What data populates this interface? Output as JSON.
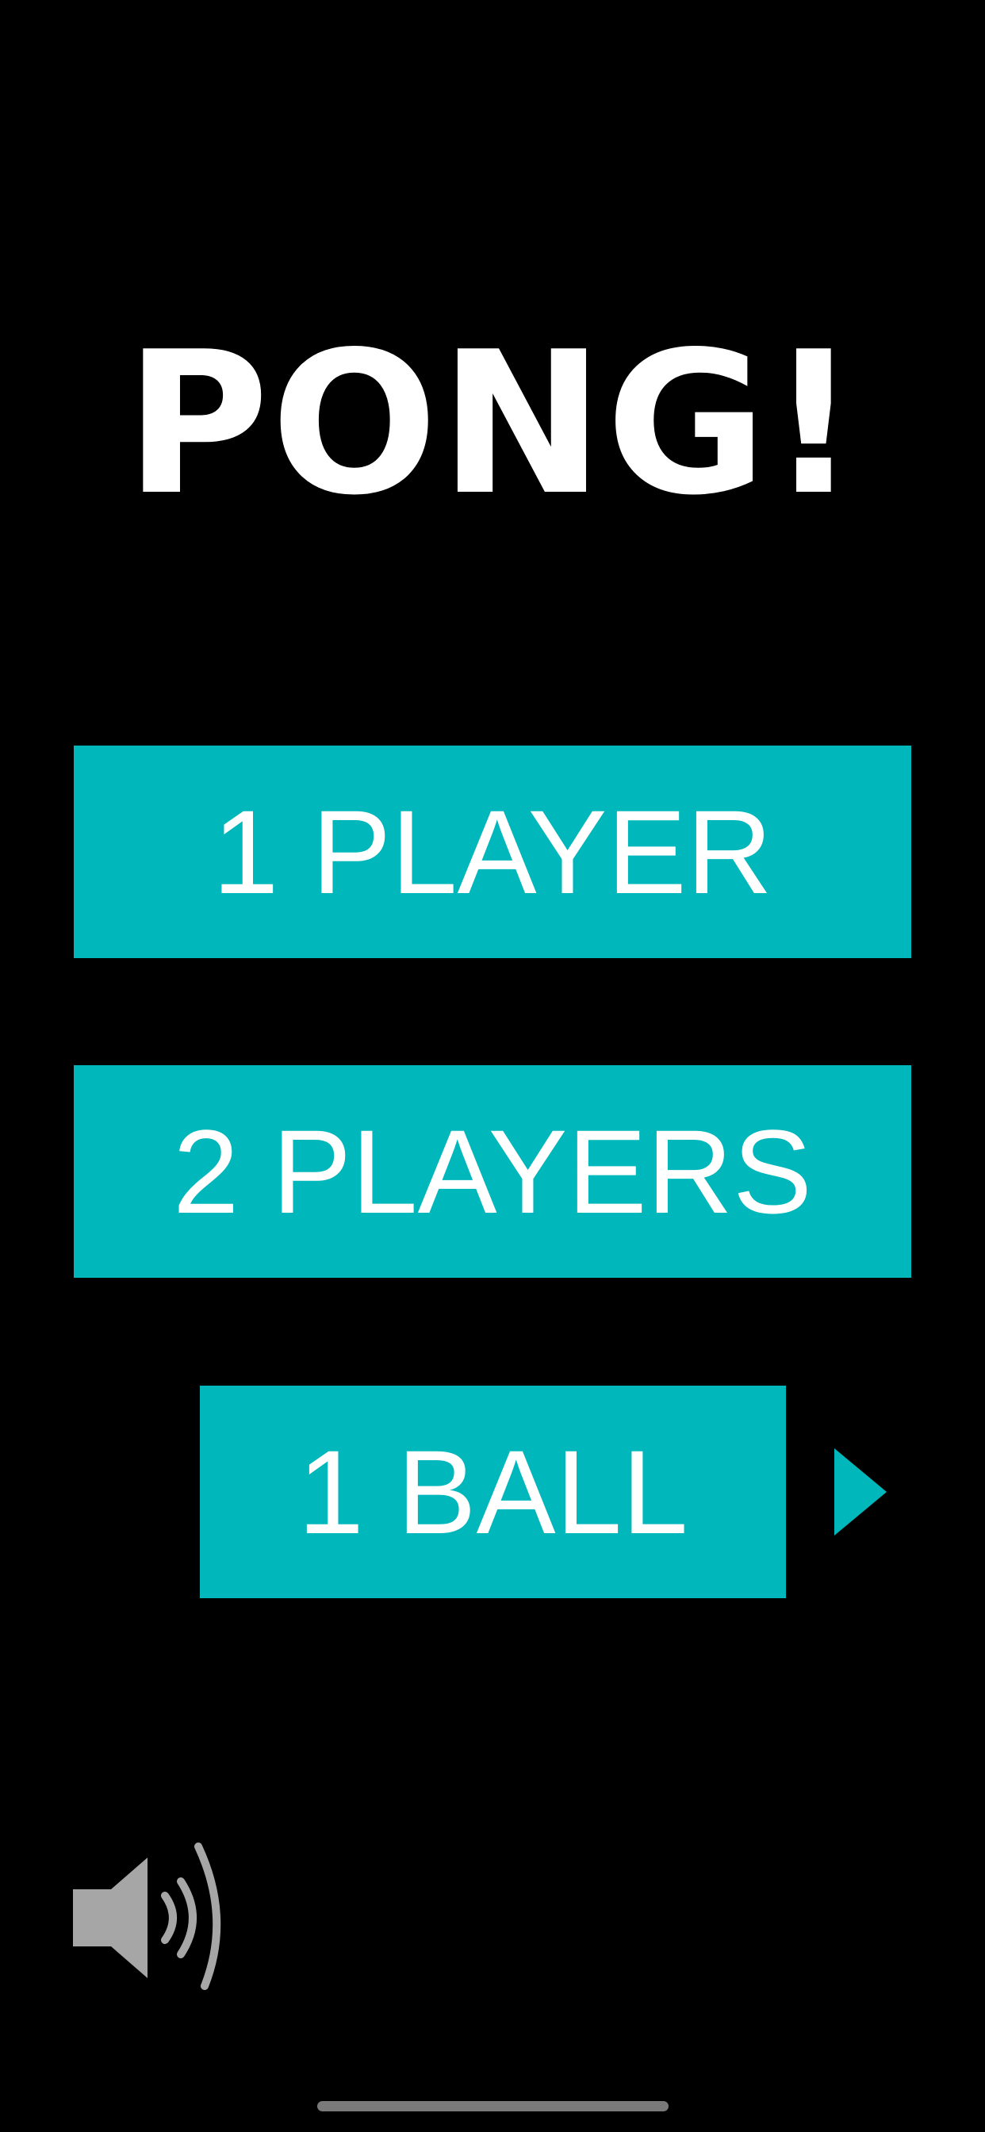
{
  "title": "PONG!",
  "menu": {
    "one_player_label": "1 PLAYER",
    "two_players_label": "2 PLAYERS",
    "ball_label": "1 BALL"
  },
  "icons": {
    "next_arrow": "triangle-right-icon",
    "sound": "speaker-volume-icon"
  },
  "colors": {
    "background": "#000000",
    "accent": "#00b7bb",
    "text": "#ffffff",
    "sound_icon": "#a6a6a6"
  }
}
